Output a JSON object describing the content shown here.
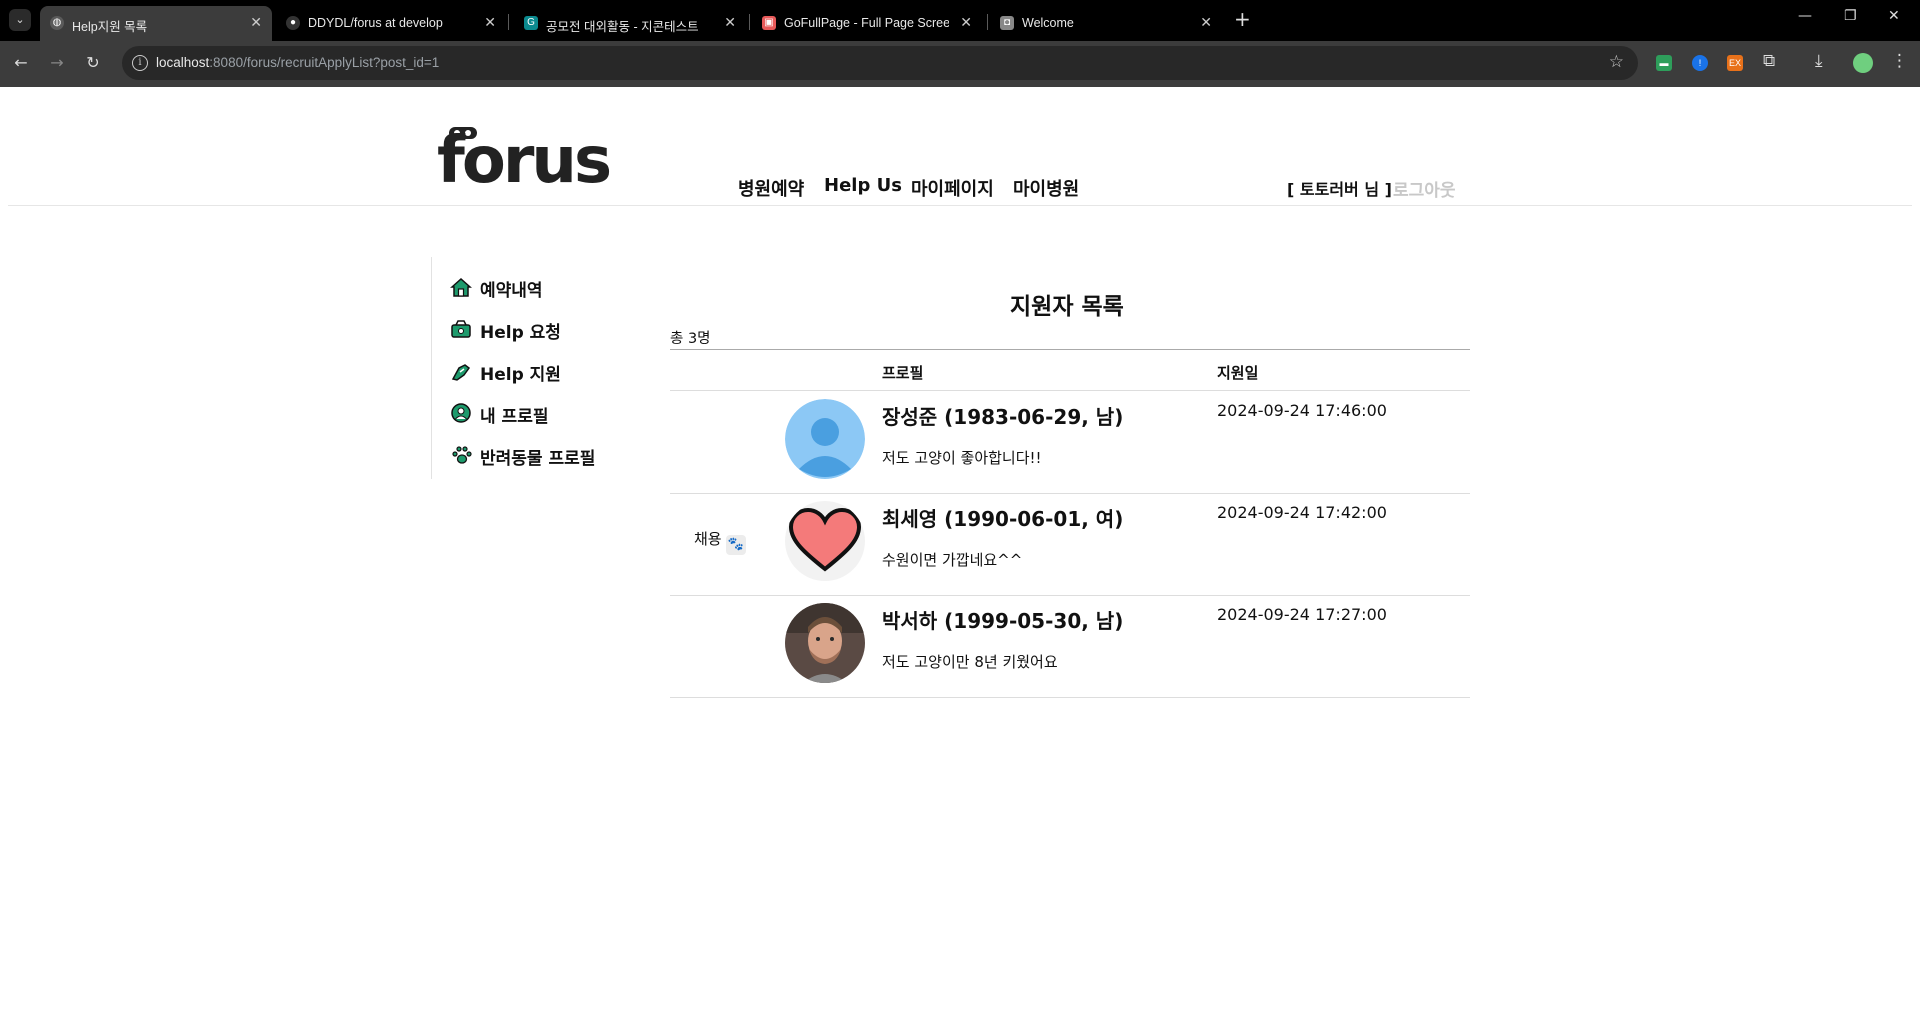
{
  "browser": {
    "tabs": [
      {
        "title": "Help지원 목록",
        "active": true
      },
      {
        "title": "DDYDL/forus at develop",
        "active": false
      },
      {
        "title": "공모전 대외활동 - 지콘테스트",
        "active": false
      },
      {
        "title": "GoFullPage - Full Page Screen",
        "active": false
      },
      {
        "title": "Welcome",
        "active": false
      }
    ],
    "url_host": "localhost",
    "url_rest": ":8080/forus/recruitApplyList?post_id=1"
  },
  "header": {
    "logo": "forus",
    "nav": [
      "병원예약",
      "Help Us",
      "마이페이지",
      "마이병원"
    ],
    "user": "[ 토토러버 님 ]",
    "logout": "로그아웃"
  },
  "sidebar": {
    "items": [
      {
        "label": "예약내역",
        "icon": "house-icon"
      },
      {
        "label": "Help 요청",
        "icon": "help-request-icon"
      },
      {
        "label": "Help 지원",
        "icon": "help-support-icon"
      },
      {
        "label": "내 프로필",
        "icon": "profile-icon"
      },
      {
        "label": "반려동물 프로필",
        "icon": "paw-icon"
      }
    ]
  },
  "main": {
    "title": "지원자 목록",
    "total": "총 3명",
    "columns": {
      "profile": "프로필",
      "date": "지원일"
    },
    "applicants": [
      {
        "hire": "",
        "name": "장성준 (1983-06-29, 남)",
        "message": "저도 고양이 좋아합니다!!",
        "date": "2024-09-24 17:46:00",
        "avatar": "default-avatar"
      },
      {
        "hire": "채용",
        "name": "최세영 (1990-06-01, 여)",
        "message": "수원이면 가깝네요^^",
        "date": "2024-09-24 17:42:00",
        "avatar": "heart-avatar"
      },
      {
        "hire": "",
        "name": "박서하 (1999-05-30, 남)",
        "message": "저도 고양이만 8년 키웠어요",
        "date": "2024-09-24 17:27:00",
        "avatar": "photo-avatar"
      }
    ]
  },
  "colors": {
    "accent_green": "#1d9a6c",
    "logout_gray": "#c8c8c8"
  }
}
